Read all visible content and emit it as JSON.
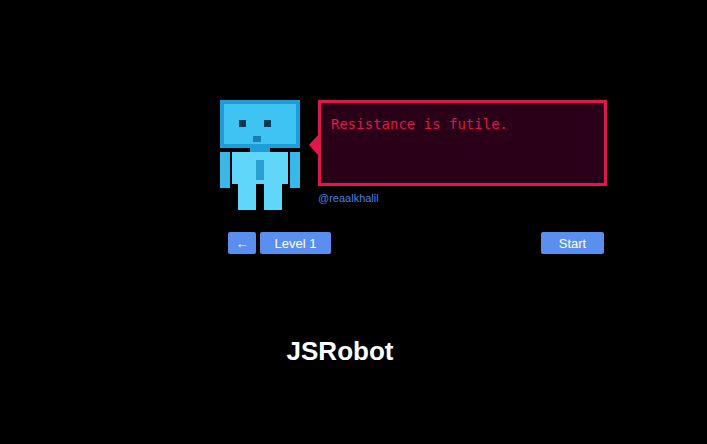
{
  "game": {
    "title": "JSRobot"
  },
  "speech": {
    "text": "Resistance is futile."
  },
  "credit": "@reaalkhalil",
  "controls": {
    "back": "←",
    "level": "Level 1",
    "start": "Start"
  }
}
